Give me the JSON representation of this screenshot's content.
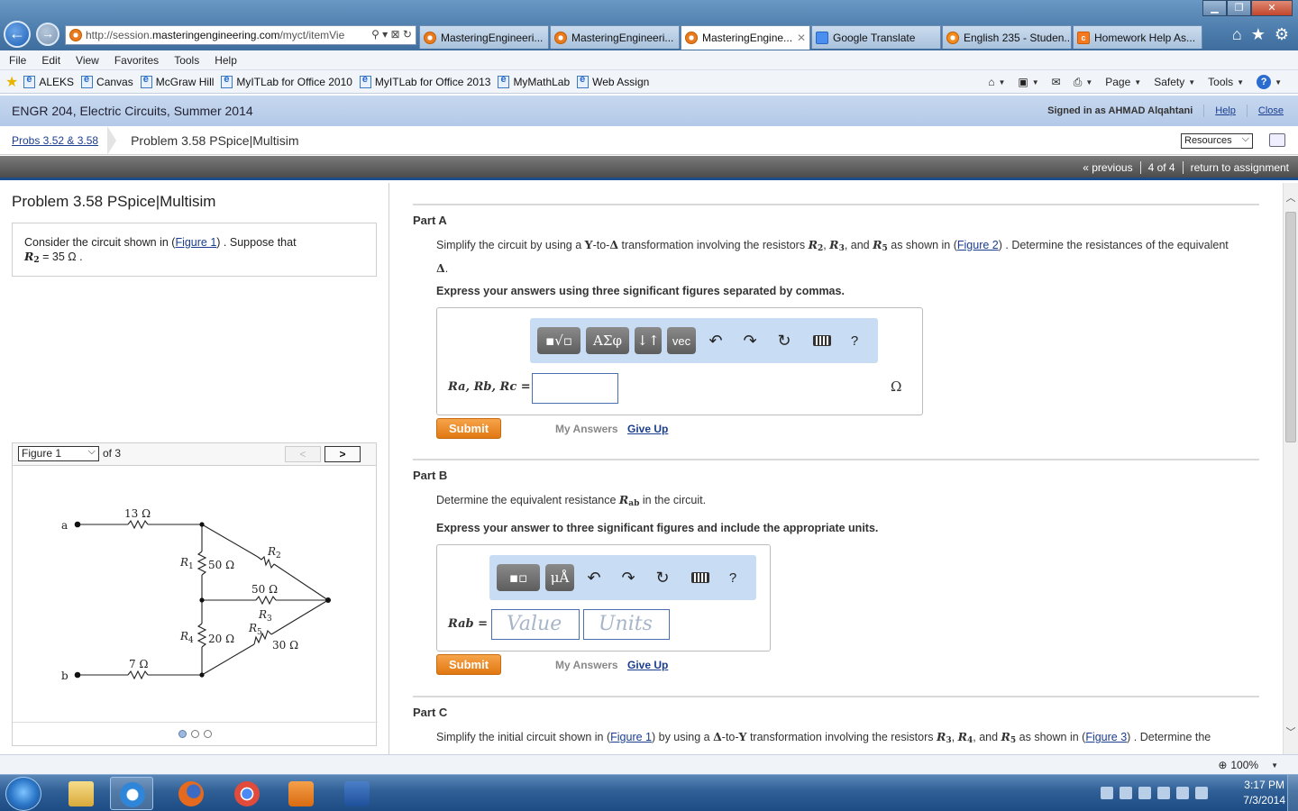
{
  "browser": {
    "address": {
      "prefix": "http://session.",
      "domain": "masteringengineering.com",
      "path": "/myct/itemVie"
    },
    "tabs": [
      {
        "label": "MasteringEngineeri...",
        "active": false,
        "icon": "mastering-icon"
      },
      {
        "label": "MasteringEngineeri...",
        "active": false,
        "icon": "mastering-icon"
      },
      {
        "label": "MasteringEngine...",
        "active": true,
        "icon": "mastering-icon"
      },
      {
        "label": "Google Translate",
        "active": false,
        "icon": "translate-icon"
      },
      {
        "label": "English 235 - Studen...",
        "active": false,
        "icon": "english-icon"
      },
      {
        "label": "Homework Help As...",
        "active": false,
        "icon": "chegg-icon"
      }
    ],
    "menu": [
      "File",
      "Edit",
      "View",
      "Favorites",
      "Tools",
      "Help"
    ],
    "favorites": [
      "ALEKS",
      "Canvas",
      "McGraw Hill",
      "MyITLab for Office 2010",
      "MyITLab for Office 2013",
      "MyMathLab",
      "Web Assign"
    ],
    "commands": {
      "page": "Page",
      "safety": "Safety",
      "tools": "Tools"
    },
    "zoom": "100%"
  },
  "header": {
    "course": "ENGR 204, Electric Circuits, Summer 2014",
    "signed_in": "Signed in as AHMAD Alqahtani",
    "help": "Help",
    "close": "Close",
    "breadcrumb_link": "Probs 3.52 & 3.58",
    "breadcrumb_current": "Problem 3.58 PSpice|Multisim",
    "resources": "Resources",
    "nav": {
      "previous": "« previous",
      "position": "4 of 4",
      "return": "return to assignment"
    }
  },
  "problem": {
    "title": "Problem 3.58 PSpice|Multisim",
    "intro_pre": "Consider the circuit shown in (",
    "figure_link": "Figure 1",
    "intro_post": ") . Suppose that",
    "given_var": "R",
    "given_sub": "2",
    "given_value": " = 35 Ω ."
  },
  "figure": {
    "selected": "Figure 1",
    "of": "of 3",
    "prev": "<",
    "next": ">",
    "labels": {
      "r13": "13 Ω",
      "r1": "R",
      "r1_sub": "1",
      "r1_val": "50 Ω",
      "r2": "R",
      "r2_sub": "2",
      "r3_val": "50 Ω",
      "r3": "R",
      "r3_sub": "3",
      "r5": "R",
      "r5_sub": "5",
      "r4": "R",
      "r4_sub": "4",
      "r4_val": "20 Ω",
      "r5_val": "30 Ω",
      "r7": "7 Ω",
      "node_a": "a",
      "node_b": "b"
    },
    "dots": 3,
    "active_dot": 0
  },
  "parts": {
    "a": {
      "title": "Part A",
      "text_1": "Simplify the circuit by using a ",
      "text_y": "Y",
      "text_2": "-to-",
      "text_delta": "Δ",
      "text_3": " transformation involving the resistors ",
      "r2": "R",
      "r2_sub": "2",
      "comma1": ", ",
      "r3": "R",
      "r3_sub": "3",
      "and": ", and ",
      "r5": "R",
      "r5_sub": "5",
      "text_4": " as shown in (",
      "figure_link": "Figure 2",
      "text_5": ") . Determine the resistances of the equivalent ",
      "text_delta2": "Δ",
      "text_6": ".",
      "instruction": "Express your answers using three significant figures separated by commas.",
      "toolbar_greek": "ΑΣφ",
      "toolbar_arrows": "↓↑",
      "toolbar_vec": "vec",
      "toolbar_help": "?",
      "answer_label": "Ra, Rb, Rc =",
      "unit": "Ω",
      "submit": "Submit",
      "my_answers": "My Answers",
      "give_up": "Give Up"
    },
    "b": {
      "title": "Part B",
      "text_1": "Determine the equivalent resistance ",
      "var": "R",
      "var_sub": "ab",
      "text_2": " in the circuit.",
      "instruction": "Express your answer to three significant figures and include the appropriate units.",
      "toolbar_units": "μÅ",
      "toolbar_help": "?",
      "answer_label": "Rab =",
      "value_placeholder": "Value",
      "units_placeholder": "Units",
      "submit": "Submit",
      "my_answers": "My Answers",
      "give_up": "Give Up"
    },
    "c": {
      "title": "Part C",
      "text_1": "Simplify the initial circuit shown in (",
      "figure_link": "Figure 1",
      "text_2": ") by using a ",
      "text_delta": "Δ",
      "text_3": "-to-",
      "text_y": "Y",
      "text_4": " transformation involving the resistors ",
      "r3": "R",
      "r3_sub": "3",
      "comma1": ", ",
      "r4": "R",
      "r4_sub": "4",
      "and": ", and ",
      "r5": "R",
      "r5_sub": "5",
      "text_5": " as shown in (",
      "figure_link2": "Figure 3",
      "text_6": ") . Determine the"
    }
  },
  "taskbar": {
    "time": "3:17 PM",
    "date": "7/3/2014"
  }
}
